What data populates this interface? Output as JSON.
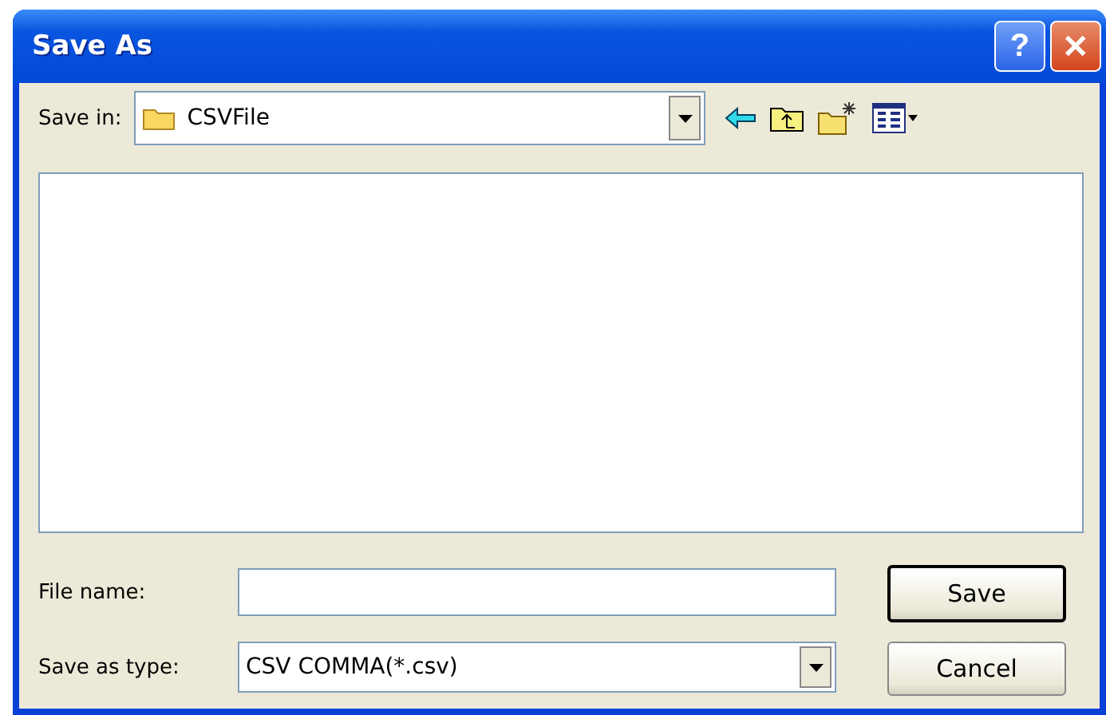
{
  "window": {
    "title": "Save As",
    "help_button": "?",
    "close_button": "✕"
  },
  "save_in": {
    "label": "Save in:",
    "value": "CSVFile"
  },
  "file_name": {
    "label": "File name:"
  },
  "save_as_type": {
    "label": "Save as type:",
    "value": "CSV COMMA(*.csv)"
  },
  "buttons": [
    {
      "label": "Save",
      "default": true
    },
    {
      "label": "Cancel",
      "default": false
    }
  ]
}
